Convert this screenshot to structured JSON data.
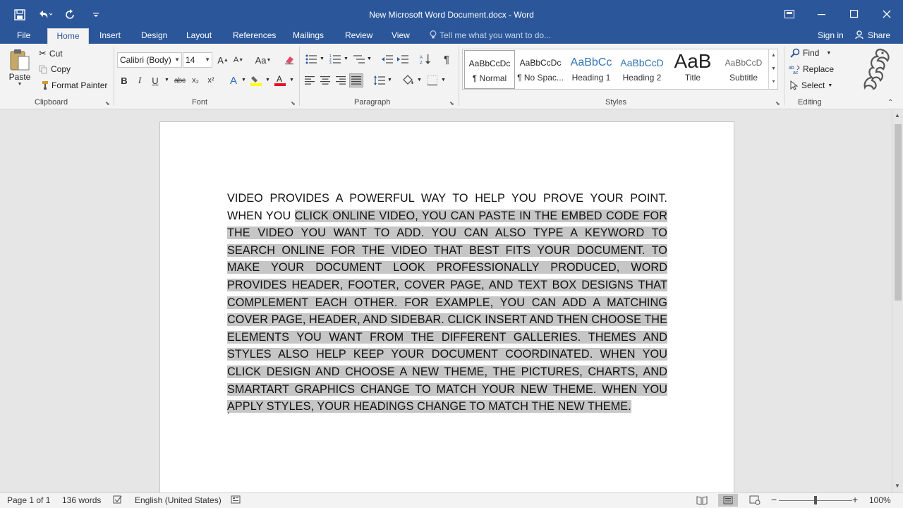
{
  "window": {
    "title": "New Microsoft Word Document.docx - Word"
  },
  "tabs": [
    {
      "label": "File"
    },
    {
      "label": "Home",
      "active": true
    },
    {
      "label": "Insert"
    },
    {
      "label": "Design"
    },
    {
      "label": "Layout"
    },
    {
      "label": "References"
    },
    {
      "label": "Mailings"
    },
    {
      "label": "Review"
    },
    {
      "label": "View"
    }
  ],
  "tell_me": {
    "placeholder": "Tell me what you want to do..."
  },
  "account": {
    "signin": "Sign in",
    "share": "Share"
  },
  "clipboard": {
    "label": "Clipboard",
    "paste": "Paste",
    "cut": "Cut",
    "copy": "Copy",
    "format_painter": "Format Painter"
  },
  "font": {
    "label": "Font",
    "family": "Calibri (Body)",
    "size": "14",
    "bold": "B",
    "italic": "I",
    "underline": "U",
    "strike": "abc",
    "subscript": "x₂",
    "superscript": "x²",
    "grow": "A",
    "shrink": "A",
    "change_case": "Aa",
    "text_color": "#e81123",
    "highlight_color": "#ffff00"
  },
  "paragraph": {
    "label": "Paragraph"
  },
  "styles": {
    "label": "Styles",
    "items": [
      {
        "preview": "AaBbCcDc",
        "name": "¶ Normal",
        "selected": true
      },
      {
        "preview": "AaBbCcDc",
        "name": "¶ No Spac..."
      },
      {
        "preview": "AaBbCc",
        "name": "Heading 1"
      },
      {
        "preview": "AaBbCcD",
        "name": "Heading 2"
      },
      {
        "preview": "AaB",
        "name": "Title"
      },
      {
        "preview": "AaBbCcD",
        "name": "Subtitle"
      }
    ]
  },
  "editing": {
    "label": "Editing",
    "find": "Find",
    "replace": "Replace",
    "select": "Select"
  },
  "document": {
    "first_line": "VIDEO PROVIDES A POWERFUL WAY TO HELP YOU PROVE YOUR POINT. WHEN YOU ",
    "selected_text": "CLICK ONLINE VIDEO, YOU CAN PASTE IN THE EMBED CODE FOR THE VIDEO YOU WANT TO ADD. YOU CAN ALSO TYPE A KEYWORD TO SEARCH ONLINE FOR THE VIDEO THAT BEST FITS YOUR DOCUMENT. TO MAKE YOUR DOCUMENT LOOK PROFESSIONALLY PRODUCED, WORD PROVIDES HEADER, FOOTER, COVER PAGE, AND TEXT BOX DESIGNS THAT COMPLEMENT EACH OTHER. FOR EXAMPLE, YOU CAN ADD A MATCHING COVER PAGE, HEADER, AND SIDEBAR. CLICK INSERT AND THEN CHOOSE THE ELEMENTS YOU WANT FROM THE DIFFERENT GALLERIES. THEMES AND STYLES ALSO HELP KEEP YOUR DOCUMENT COORDINATED. WHEN YOU CLICK DESIGN AND CHOOSE A NEW THEME, THE PICTURES, CHARTS, AND SMARTART GRAPHICS CHANGE TO MATCH YOUR NEW THEME. WHEN YOU APPLY STYLES, YOUR HEADINGS CHANGE TO MATCH THE NEW THEME.",
    "second_para": "."
  },
  "status": {
    "page": "Page 1 of 1",
    "words": "136 words",
    "language": "English (United States)",
    "zoom": "100%",
    "zoom_fraction": 0.5
  },
  "colors": {
    "accent": "#2b579a",
    "selection": "#c6c6c6"
  }
}
